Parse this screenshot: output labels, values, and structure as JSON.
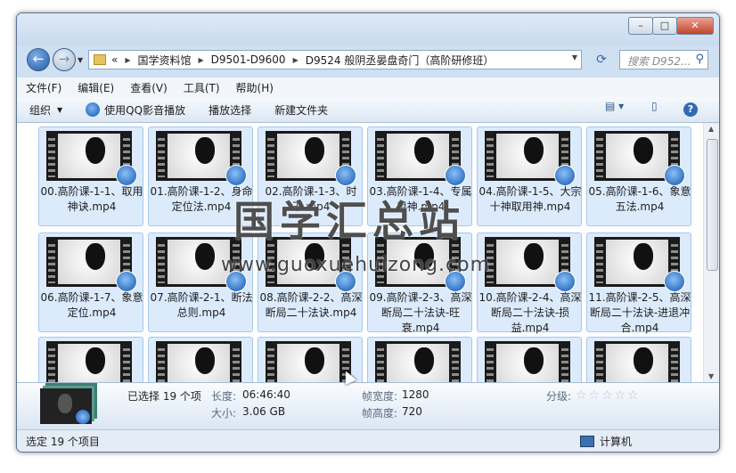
{
  "breadcrumbs": [
    "国学资料馆",
    "D9501-D9600",
    "D9524 般阴丞晏盘奇门（高阶研修班）"
  ],
  "breadcrumb_prefix": "«",
  "search": {
    "placeholder": "搜索 D952..."
  },
  "menus": [
    "文件(F)",
    "编辑(E)",
    "查看(V)",
    "工具(T)",
    "帮助(H)"
  ],
  "toolbar": {
    "organize": "组织",
    "play_qq": "使用QQ影音播放",
    "play_selection": "播放选择",
    "new_folder": "新建文件夹"
  },
  "files": [
    "00.高阶课-1-1、取用神诀.mp4",
    "01.高阶课-1-2、身命定位法.mp4",
    "02.高阶课-1-3、时干.mp4",
    "03.高阶课-1-4、专属用神.mp4",
    "04.高阶课-1-5、大宗十神取用神.mp4",
    "05.高阶课-1-6、象意五法.mp4",
    "06.高阶课-1-7、象意定位.mp4",
    "07.高阶课-2-1、断法总则.mp4",
    "08.高阶课-2-2、高深断局二十法诀.mp4",
    "09.高阶课-2-3、高深断局二十法诀-旺衰.mp4",
    "10.高阶课-2-4、高深断局二十法诀-损益.mp4",
    "11.高阶课-2-5、高深断局二十法诀-进退冲合.mp4"
  ],
  "watermark": {
    "title": "国学汇总站",
    "url": "www.guoxuehuizong.com"
  },
  "details": {
    "selected": "已选择 19 个项",
    "length_label": "长度:",
    "length": "06:46:40",
    "size_label": "大小:",
    "size": "3.06 GB",
    "frame_width_label": "帧宽度:",
    "frame_width": "1280",
    "frame_height_label": "帧高度:",
    "frame_height": "720",
    "rating_label": "分级:",
    "rating_stars": "☆☆☆☆☆"
  },
  "status": {
    "left": "选定 19 个项目",
    "right": "计算机"
  }
}
